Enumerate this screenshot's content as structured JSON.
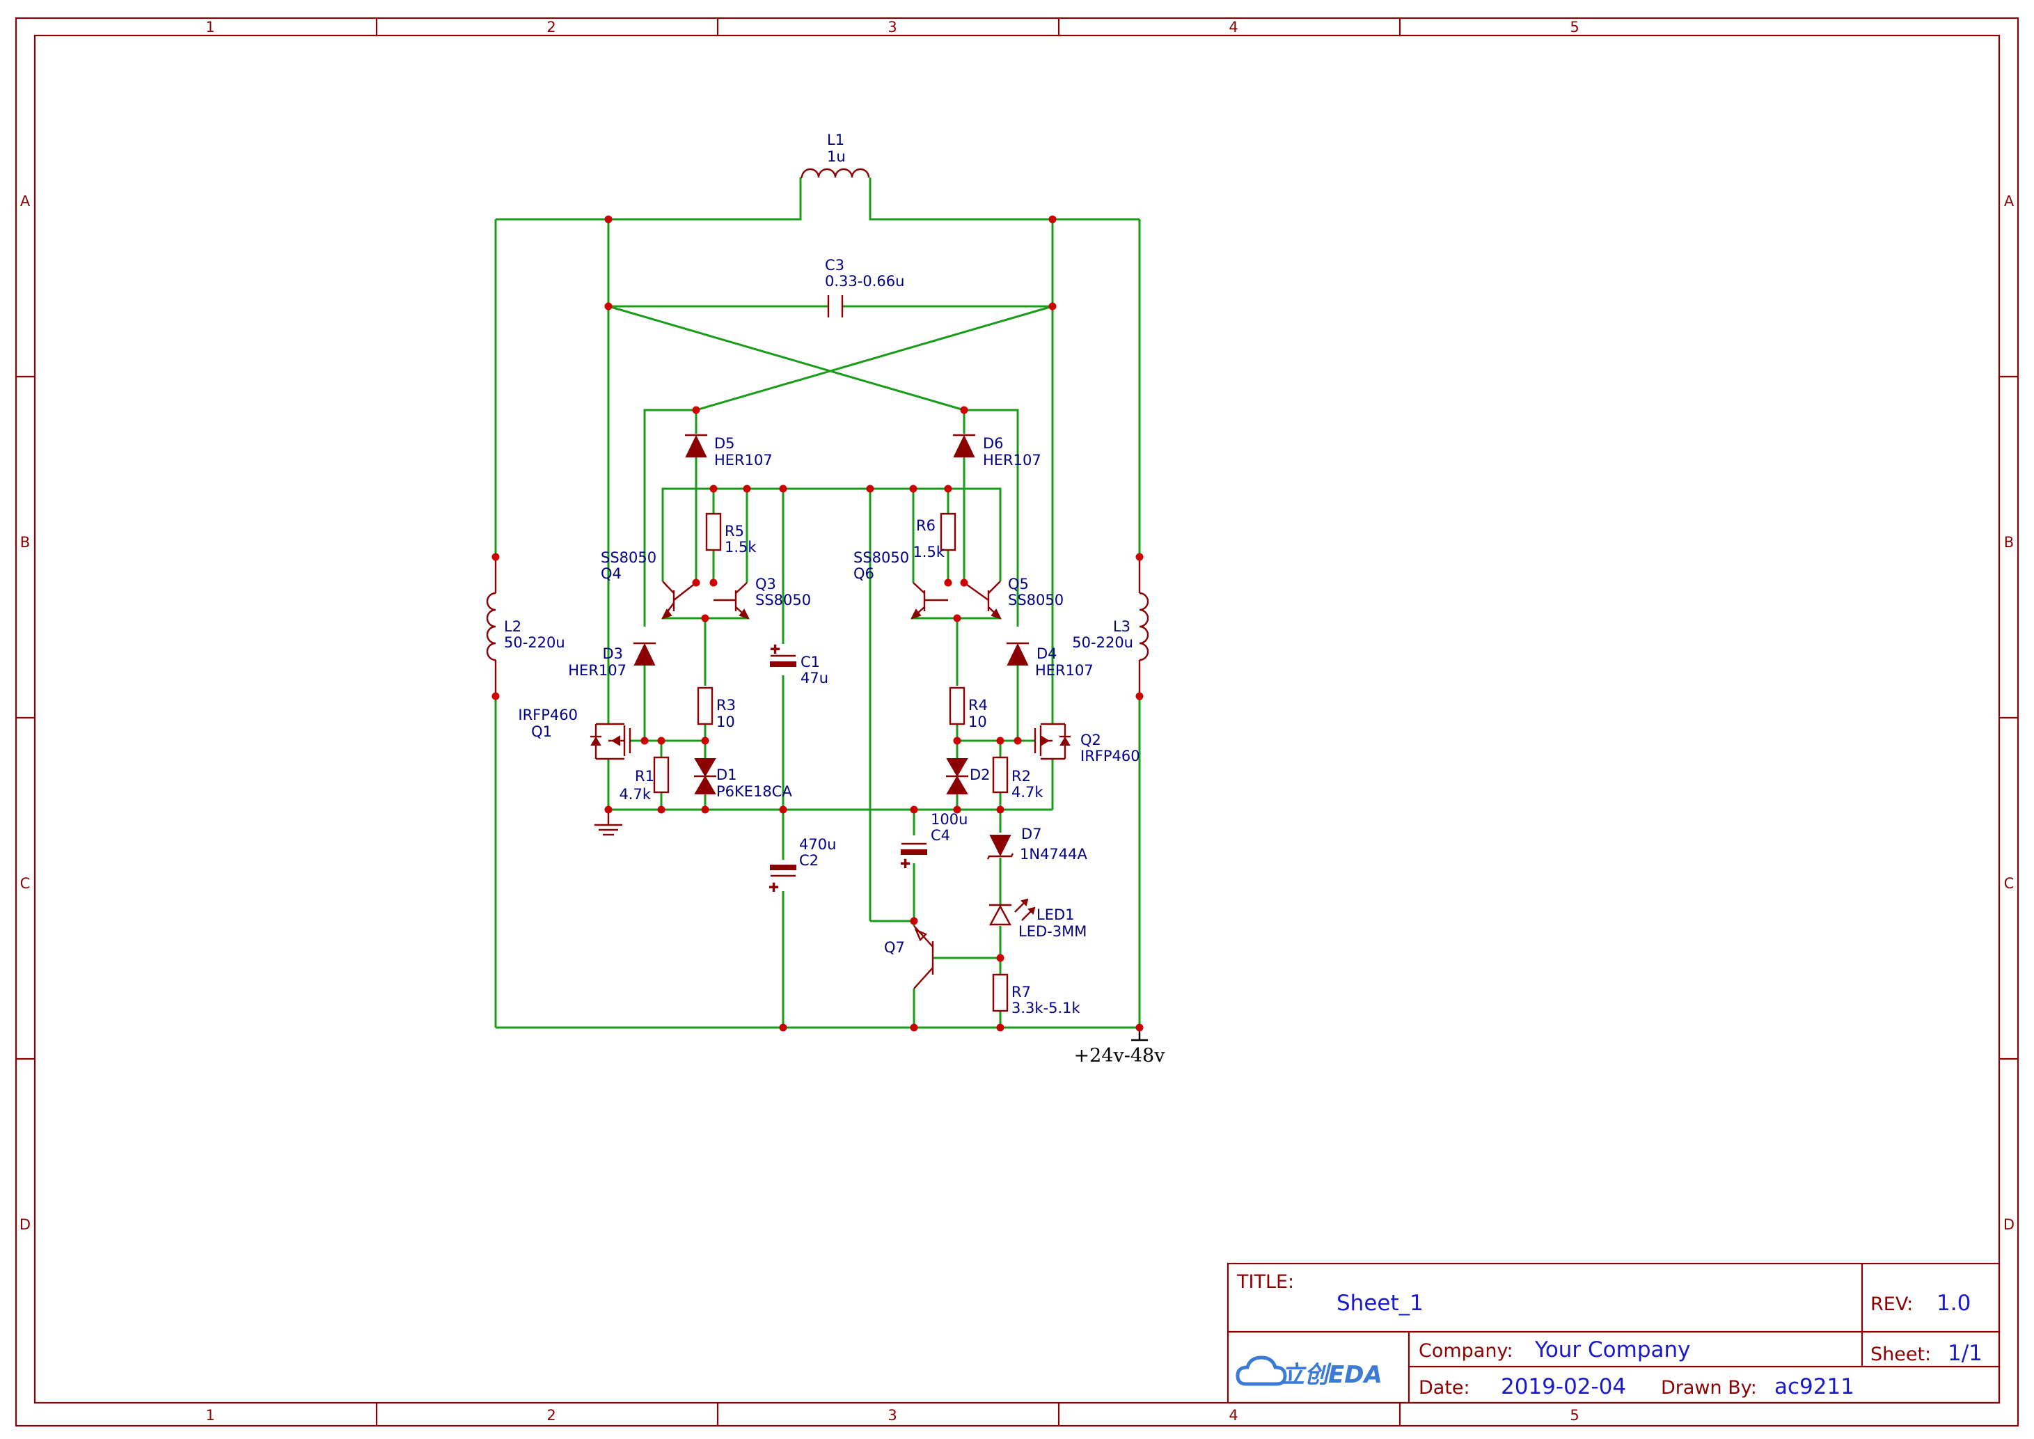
{
  "zones": {
    "columns": [
      "1",
      "2",
      "3",
      "4",
      "5"
    ],
    "rows": [
      "A",
      "B",
      "C",
      "D"
    ]
  },
  "components": {
    "L1": {
      "ref": "L1",
      "value": "1u"
    },
    "L2": {
      "ref": "L2",
      "value": "50-220u"
    },
    "L3": {
      "ref": "L3",
      "value": "50-220u"
    },
    "C1": {
      "ref": "C1",
      "value": "47u"
    },
    "C2": {
      "ref": "C2",
      "value": "470u"
    },
    "C3": {
      "ref": "C3",
      "value": "0.33-0.66u"
    },
    "C4": {
      "ref": "C4",
      "value": "100u"
    },
    "D1": {
      "ref": "D1",
      "value": "P6KE18CA"
    },
    "D2": {
      "ref": "D2",
      "value": ""
    },
    "D3": {
      "ref": "D3",
      "value": "HER107"
    },
    "D4": {
      "ref": "D4",
      "value": "HER107"
    },
    "D5": {
      "ref": "D5",
      "value": "HER107"
    },
    "D6": {
      "ref": "D6",
      "value": "HER107"
    },
    "D7": {
      "ref": "D7",
      "value": "1N4744A"
    },
    "LED1": {
      "ref": "LED1",
      "value": "LED-3MM"
    },
    "R1": {
      "ref": "R1",
      "value": "4.7k"
    },
    "R2": {
      "ref": "R2",
      "value": "4.7k"
    },
    "R3": {
      "ref": "R3",
      "value": "10"
    },
    "R4": {
      "ref": "R4",
      "value": "10"
    },
    "R5": {
      "ref": "R5",
      "value": "1.5k"
    },
    "R6": {
      "ref": "R6",
      "value": "1.5k"
    },
    "R7": {
      "ref": "R7",
      "value": "3.3k-5.1k"
    },
    "Q1": {
      "ref": "Q1",
      "value": "IRFP460"
    },
    "Q2": {
      "ref": "Q2",
      "value": "IRFP460"
    },
    "Q3": {
      "ref": "Q3",
      "value": "SS8050"
    },
    "Q4": {
      "ref": "Q4",
      "value": "SS8050"
    },
    "Q5": {
      "ref": "Q5",
      "value": "SS8050"
    },
    "Q6": {
      "ref": "Q6",
      "value": "SS8050"
    },
    "Q7": {
      "ref": "Q7",
      "value": ""
    }
  },
  "supply_label": "+24v-48v",
  "title_block": {
    "title_key": "TITLE:",
    "title": "Sheet_1",
    "rev_key": "REV:",
    "rev": "1.0",
    "company_key": "Company:",
    "company": "Your Company",
    "sheet_key": "Sheet:",
    "sheet": "1/1",
    "date_key": "Date:",
    "date": "2019-02-04",
    "drawn_by_key": "Drawn By:",
    "drawn_by": "ac9211",
    "logo_text": "立创EDA"
  },
  "colors": {
    "frame": "#8b0000",
    "wire": "#1a9c1a",
    "junction": "#cc0000",
    "label": "#000080",
    "title_value": "#1a1acc"
  }
}
